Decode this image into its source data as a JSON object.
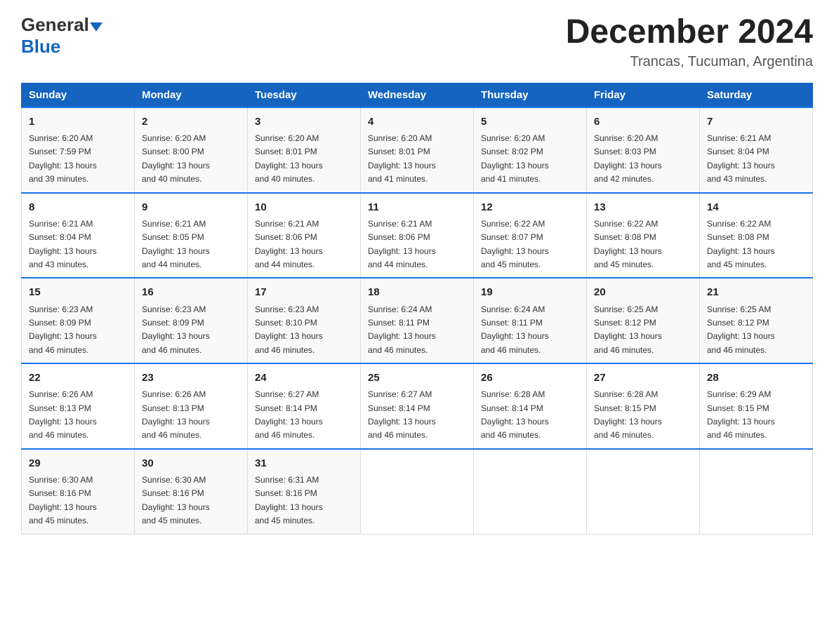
{
  "header": {
    "logo_general": "General",
    "logo_arrow": "▶",
    "logo_blue": "Blue",
    "month_title": "December 2024",
    "location": "Trancas, Tucuman, Argentina"
  },
  "days_of_week": [
    "Sunday",
    "Monday",
    "Tuesday",
    "Wednesday",
    "Thursday",
    "Friday",
    "Saturday"
  ],
  "weeks": [
    [
      {
        "day": "1",
        "sunrise": "6:20 AM",
        "sunset": "7:59 PM",
        "daylight": "13 hours and 39 minutes."
      },
      {
        "day": "2",
        "sunrise": "6:20 AM",
        "sunset": "8:00 PM",
        "daylight": "13 hours and 40 minutes."
      },
      {
        "day": "3",
        "sunrise": "6:20 AM",
        "sunset": "8:01 PM",
        "daylight": "13 hours and 40 minutes."
      },
      {
        "day": "4",
        "sunrise": "6:20 AM",
        "sunset": "8:01 PM",
        "daylight": "13 hours and 41 minutes."
      },
      {
        "day": "5",
        "sunrise": "6:20 AM",
        "sunset": "8:02 PM",
        "daylight": "13 hours and 41 minutes."
      },
      {
        "day": "6",
        "sunrise": "6:20 AM",
        "sunset": "8:03 PM",
        "daylight": "13 hours and 42 minutes."
      },
      {
        "day": "7",
        "sunrise": "6:21 AM",
        "sunset": "8:04 PM",
        "daylight": "13 hours and 43 minutes."
      }
    ],
    [
      {
        "day": "8",
        "sunrise": "6:21 AM",
        "sunset": "8:04 PM",
        "daylight": "13 hours and 43 minutes."
      },
      {
        "day": "9",
        "sunrise": "6:21 AM",
        "sunset": "8:05 PM",
        "daylight": "13 hours and 44 minutes."
      },
      {
        "day": "10",
        "sunrise": "6:21 AM",
        "sunset": "8:06 PM",
        "daylight": "13 hours and 44 minutes."
      },
      {
        "day": "11",
        "sunrise": "6:21 AM",
        "sunset": "8:06 PM",
        "daylight": "13 hours and 44 minutes."
      },
      {
        "day": "12",
        "sunrise": "6:22 AM",
        "sunset": "8:07 PM",
        "daylight": "13 hours and 45 minutes."
      },
      {
        "day": "13",
        "sunrise": "6:22 AM",
        "sunset": "8:08 PM",
        "daylight": "13 hours and 45 minutes."
      },
      {
        "day": "14",
        "sunrise": "6:22 AM",
        "sunset": "8:08 PM",
        "daylight": "13 hours and 45 minutes."
      }
    ],
    [
      {
        "day": "15",
        "sunrise": "6:23 AM",
        "sunset": "8:09 PM",
        "daylight": "13 hours and 46 minutes."
      },
      {
        "day": "16",
        "sunrise": "6:23 AM",
        "sunset": "8:09 PM",
        "daylight": "13 hours and 46 minutes."
      },
      {
        "day": "17",
        "sunrise": "6:23 AM",
        "sunset": "8:10 PM",
        "daylight": "13 hours and 46 minutes."
      },
      {
        "day": "18",
        "sunrise": "6:24 AM",
        "sunset": "8:11 PM",
        "daylight": "13 hours and 46 minutes."
      },
      {
        "day": "19",
        "sunrise": "6:24 AM",
        "sunset": "8:11 PM",
        "daylight": "13 hours and 46 minutes."
      },
      {
        "day": "20",
        "sunrise": "6:25 AM",
        "sunset": "8:12 PM",
        "daylight": "13 hours and 46 minutes."
      },
      {
        "day": "21",
        "sunrise": "6:25 AM",
        "sunset": "8:12 PM",
        "daylight": "13 hours and 46 minutes."
      }
    ],
    [
      {
        "day": "22",
        "sunrise": "6:26 AM",
        "sunset": "8:13 PM",
        "daylight": "13 hours and 46 minutes."
      },
      {
        "day": "23",
        "sunrise": "6:26 AM",
        "sunset": "8:13 PM",
        "daylight": "13 hours and 46 minutes."
      },
      {
        "day": "24",
        "sunrise": "6:27 AM",
        "sunset": "8:14 PM",
        "daylight": "13 hours and 46 minutes."
      },
      {
        "day": "25",
        "sunrise": "6:27 AM",
        "sunset": "8:14 PM",
        "daylight": "13 hours and 46 minutes."
      },
      {
        "day": "26",
        "sunrise": "6:28 AM",
        "sunset": "8:14 PM",
        "daylight": "13 hours and 46 minutes."
      },
      {
        "day": "27",
        "sunrise": "6:28 AM",
        "sunset": "8:15 PM",
        "daylight": "13 hours and 46 minutes."
      },
      {
        "day": "28",
        "sunrise": "6:29 AM",
        "sunset": "8:15 PM",
        "daylight": "13 hours and 46 minutes."
      }
    ],
    [
      {
        "day": "29",
        "sunrise": "6:30 AM",
        "sunset": "8:16 PM",
        "daylight": "13 hours and 45 minutes."
      },
      {
        "day": "30",
        "sunrise": "6:30 AM",
        "sunset": "8:16 PM",
        "daylight": "13 hours and 45 minutes."
      },
      {
        "day": "31",
        "sunrise": "6:31 AM",
        "sunset": "8:16 PM",
        "daylight": "13 hours and 45 minutes."
      },
      null,
      null,
      null,
      null
    ]
  ],
  "labels": {
    "sunrise": "Sunrise:",
    "sunset": "Sunset:",
    "daylight": "Daylight:"
  }
}
